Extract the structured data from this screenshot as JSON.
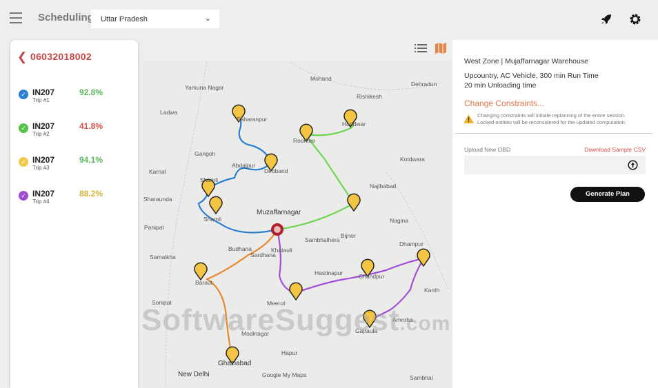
{
  "header": {
    "title": "Scheduling",
    "region": "Uttar Pradesh"
  },
  "panel": {
    "code": "06032018002",
    "trips": [
      {
        "name": "IN207",
        "sub": "Trip #1",
        "pct": "92.8%",
        "color": "#2b7fd0",
        "pct_color": "#5cb85c"
      },
      {
        "name": "IN207",
        "sub": "Trip #2",
        "pct": "41.8%",
        "color": "#55c24a",
        "pct_color": "#d9534f"
      },
      {
        "name": "IN207",
        "sub": "Trip #3",
        "pct": "94.1%",
        "color": "#f3c94a",
        "pct_color": "#5cb85c"
      },
      {
        "name": "IN207",
        "sub": "Trip #4",
        "pct": "88.2%",
        "color": "#9b4fd0",
        "pct_color": "#d6b33c"
      }
    ]
  },
  "right": {
    "zone": "West Zone | Mujaffarnagar Warehouse",
    "line1": "Upcountry, AC Vehicle, 300 min Run Time",
    "line2": "20 min Unloading time",
    "change": "Change Constraints...",
    "warn1": "Changing constraints will initiate replanning of the entire session.",
    "warn2": "Locked entities will be reconsidered for the updated computation.",
    "upload": "Upload New OBD",
    "download": "Download Sample CSV",
    "generate": "Generate Plan"
  },
  "map": {
    "places": [
      "Yamuna Nagar",
      "Saharanpur",
      "Roorkee",
      "Haridwar",
      "Rishikesh",
      "Mohand",
      "Dehradun",
      "Gangoh",
      "Karnal",
      "Ladwa",
      "Abdalpur",
      "Deoband",
      "Shamli",
      "Muzaffarnagar",
      "Najibabad",
      "Kotdwara",
      "Bijnor",
      "Shamli",
      "Panipat",
      "Budhana",
      "Khatauli",
      "Sambhalhera",
      "Samalkha",
      "Baraut",
      "Sardhana",
      "Hastinapur",
      "Chandpur",
      "Dhampur",
      "Meerut",
      "Modinagar",
      "Amroha",
      "Gajraula",
      "Ghaziabad",
      "New Delhi",
      "Hapur",
      "Nagina",
      "Kanth",
      "Sambhal",
      "Sonipat",
      "Sharaunda"
    ],
    "credit": "Google My Maps"
  },
  "watermark": "SoftwareSuggest.com"
}
